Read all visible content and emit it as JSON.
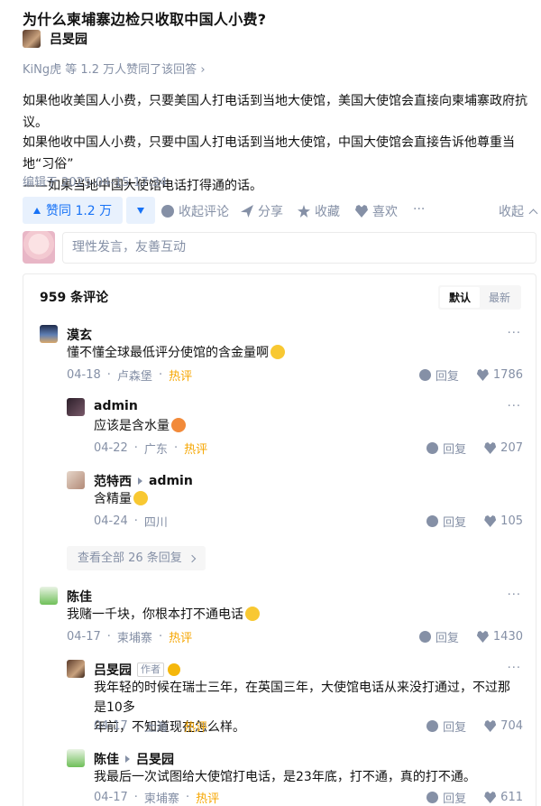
{
  "question": {
    "title": "为什么柬埔寨边检只收取中国人小费?"
  },
  "author": {
    "name": "吕旻园"
  },
  "voters": {
    "text": "KiNg虎 等 1.2 万人赞同了该回答 ›"
  },
  "answer": {
    "p1": "如果他收美国人小费，只要美国人打电话到当地大使馆，美国大使馆会直接向柬埔寨政府抗议。",
    "p2_line1": "如果他收中国人小费，只要中国人打电话到当地大使馆，中国大使馆会直接告诉他尊重当地“习俗”",
    "p2_line2": "——如果当地中国大使馆电话打得通的话。",
    "edited": "编辑于 2025-04-15 17:34"
  },
  "actions": {
    "upvote_label": "赞同 1.2 万",
    "collapse_comments": "收起评论",
    "share": "分享",
    "favorite": "收藏",
    "like": "喜欢",
    "more": "···",
    "collapse": "收起"
  },
  "compose": {
    "placeholder": "理性发言，友善互动"
  },
  "comments": {
    "count_label": "959 条评论",
    "sort_default": "默认",
    "sort_latest": "最新",
    "reply_label": "回复",
    "hot_label": "热评",
    "view_all": "查看全部 26 条回复",
    "items": [
      {
        "name": "漠玄",
        "text": "懂不懂全球最低评分使馆的含金量啊",
        "date": "04-18",
        "loc": "卢森堡",
        "hot": true,
        "likes": "1786"
      },
      {
        "name": "admin",
        "text": "应该是含水量",
        "date": "04-22",
        "loc": "广东",
        "hot": true,
        "likes": "207"
      },
      {
        "name": "范特西",
        "reply_to": "admin",
        "text": "含精量",
        "date": "04-24",
        "loc": "四川",
        "hot": false,
        "likes": "105"
      },
      {
        "name": "陈佳",
        "text": "我赌一千块，你根本打不通电话",
        "date": "04-17",
        "loc": "柬埔寨",
        "hot": true,
        "likes": "1430"
      },
      {
        "name": "吕旻园",
        "tag": "作者",
        "text_line1": "我年轻的时候在瑞士三年，在英国三年，大使馆电话从来没打通过，不过那是10多",
        "text_line2": "年前，不知道现在怎么样。",
        "date": "04-17",
        "loc": "上海",
        "hot": true,
        "likes": "704"
      },
      {
        "name": "陈佳",
        "reply_to": "吕旻园",
        "text": "我最后一次试图给大使馆打电话，是23年底，打不通，真的打不通。",
        "date": "04-17",
        "loc": "柬埔寨",
        "hot": true,
        "likes": "611"
      }
    ]
  }
}
